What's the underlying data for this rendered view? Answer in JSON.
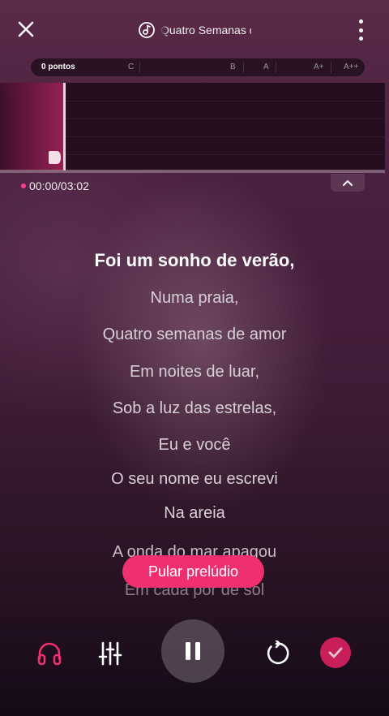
{
  "header": {
    "song_title": "Quatro Semanas de Amor",
    "close_icon": "close-icon",
    "music_icon": "music-note-icon",
    "more_icon": "more-vertical-icon"
  },
  "score_bar": {
    "points_label": "0 pontos",
    "grades": [
      "C",
      "B",
      "A",
      "A+",
      "A++"
    ]
  },
  "player": {
    "time": "00:00/03:02",
    "progress": 0
  },
  "lyrics": {
    "lines": [
      "Foi um sonho de verão,",
      "Numa praia,",
      "Quatro semanas de amor",
      "Em noites de luar,",
      "Sob a luz das estrelas,",
      "Eu e você",
      "O seu nome eu escrevi",
      "Na areia",
      "A onda do mar apagou",
      "Em cada por de sol"
    ],
    "active_index": 0
  },
  "skip_button": {
    "label": "Pular prelúdio"
  },
  "controls": {
    "icons": [
      "headphones-icon",
      "equalizer-icon",
      "pause-icon",
      "replay-icon",
      "check-icon"
    ]
  },
  "colors": {
    "accent": "#f0306e",
    "confirm": "#c81e5a",
    "active_dot": "#ff3d8b"
  }
}
